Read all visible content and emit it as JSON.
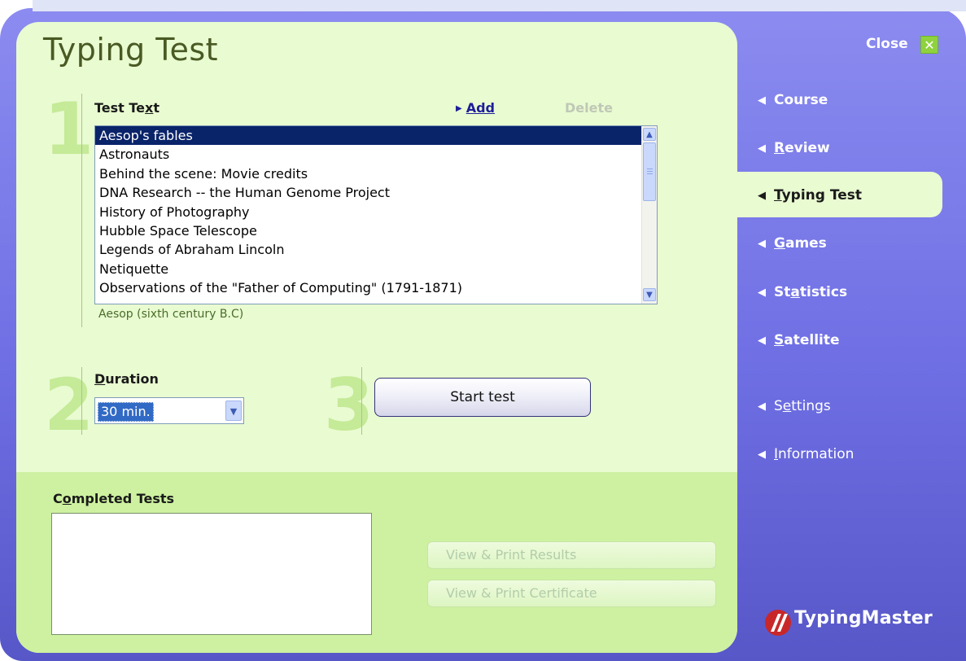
{
  "window": {
    "title": "Typing Test",
    "close_label": "Close",
    "close_icon": "close-x-icon"
  },
  "step1": {
    "number": "1",
    "label_pre": "Test Te",
    "label_u": "x",
    "label_post": "t",
    "add_label": "Add",
    "delete_label": "Delete",
    "items": [
      "Aesop's fables",
      "Astronauts",
      "Behind the scene: Movie credits",
      "DNA Research -- the Human Genome Project",
      "History of Photography",
      "Hubble Space Telescope",
      "Legends of Abraham Lincoln",
      "Netiquette",
      "Observations of the \"Father of Computing\" (1791-1871)"
    ],
    "selected_index": 0,
    "author": "Aesop (sixth century B.C)"
  },
  "step2": {
    "number": "2",
    "label_u": "D",
    "label_post": "uration",
    "value": "30 min."
  },
  "step3": {
    "number": "3",
    "start_label": "Start test"
  },
  "completed": {
    "label_pre": "C",
    "label_u": "o",
    "label_post": "mpleted Tests",
    "view_results": "View & Print Results",
    "view_certificate": "View & Print Certificate"
  },
  "sidebar": {
    "items": [
      {
        "pre": "Course",
        "u": "",
        "post": ""
      },
      {
        "pre": "",
        "u": "R",
        "post": "eview"
      },
      {
        "pre": "",
        "u": "T",
        "post": "yping Test"
      },
      {
        "pre": "",
        "u": "G",
        "post": "ames"
      },
      {
        "pre": "St",
        "u": "a",
        "post": "tistics"
      },
      {
        "pre": "",
        "u": "S",
        "post": "atellite"
      },
      {
        "pre": "S",
        "u": "e",
        "post": "ttings"
      },
      {
        "pre": "",
        "u": "I",
        "post": "nformation"
      }
    ],
    "active_index": 2
  },
  "brand": {
    "name": "TypingMaster"
  },
  "colors": {
    "panel": "#e9fbd1",
    "panel_lower": "#cdf1a0",
    "sidebar": "#7575e6",
    "selection": "#0a246a",
    "brand_red": "#c8272a"
  }
}
